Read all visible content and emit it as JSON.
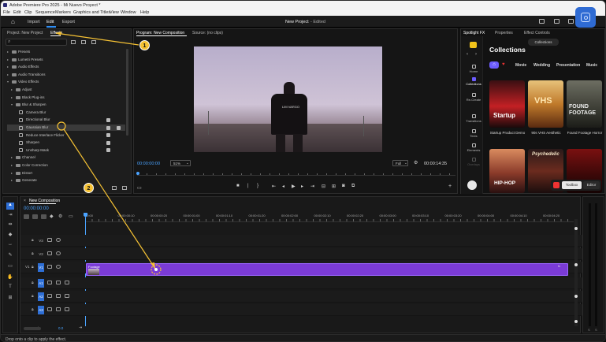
{
  "window": {
    "title": "Adobe Premiere Pro 2025 - Mi Nuevo Proyect *"
  },
  "menu": [
    "File",
    "Edit",
    "Clip",
    "Sequence",
    "Markers",
    "Graphics and Titles",
    "View",
    "Window",
    "Help"
  ],
  "workspace_tabs": {
    "import": "Import",
    "edit": "Edit",
    "export": "Export"
  },
  "project_name": "New Project",
  "project_status": "- Edited",
  "left_panel": {
    "tab_project": "Project: New Project",
    "tab_effects": "Effects",
    "tree": [
      {
        "label": "Presets",
        "depth": 0,
        "open": false,
        "kind": "folder"
      },
      {
        "label": "Lumetri Presets",
        "depth": 0,
        "open": false,
        "kind": "folder"
      },
      {
        "label": "Audio Effects",
        "depth": 0,
        "open": false,
        "kind": "folder"
      },
      {
        "label": "Audio Transitions",
        "depth": 0,
        "open": false,
        "kind": "folder"
      },
      {
        "label": "Video Effects",
        "depth": 0,
        "open": true,
        "kind": "folder"
      },
      {
        "label": "Adjust",
        "depth": 1,
        "open": false,
        "kind": "folder"
      },
      {
        "label": "Black Plug-ins",
        "depth": 1,
        "open": false,
        "kind": "folder"
      },
      {
        "label": "Blur & Sharpen",
        "depth": 1,
        "open": true,
        "kind": "folder"
      },
      {
        "label": "Camera Blur",
        "depth": 2,
        "kind": "fx",
        "badges": 0
      },
      {
        "label": "Directional Blur",
        "depth": 2,
        "kind": "fx",
        "badges": 1
      },
      {
        "label": "Gaussian Blur",
        "depth": 2,
        "kind": "fx",
        "badges": 2,
        "selected": true
      },
      {
        "label": "Reduce Interlace Flicker",
        "depth": 2,
        "kind": "fx",
        "badges": 1
      },
      {
        "label": "Sharpen",
        "depth": 2,
        "kind": "fx",
        "badges": 1
      },
      {
        "label": "Unsharp Mask",
        "depth": 2,
        "kind": "fx",
        "badges": 1
      },
      {
        "label": "Channel",
        "depth": 1,
        "open": false,
        "kind": "folder"
      },
      {
        "label": "Color Correction",
        "depth": 1,
        "open": false,
        "kind": "folder"
      },
      {
        "label": "Distort",
        "depth": 1,
        "open": false,
        "kind": "folder"
      },
      {
        "label": "Generate",
        "depth": 1,
        "open": false,
        "kind": "folder"
      }
    ]
  },
  "monitor": {
    "tab_program": "Program: New Composition",
    "tab_source": "Source: (no clips)",
    "timecode_left": "00:00:00:00",
    "zoom": "51%",
    "quality": "Full",
    "timecode_right": "00:00:14:35",
    "shirt_text": "LIM VARGO"
  },
  "spotlight": {
    "tab_spotlight": "Spotlight FX",
    "tab_properties": "Properties",
    "tab_effect_controls": "Effect Controls",
    "nav": [
      "Home",
      "Collections",
      "Re-Create",
      "Transitions",
      "Texts",
      "Elements",
      "Overlays"
    ],
    "collections_chip": "Collections",
    "heading": "Collections",
    "filters": [
      "Movie",
      "Wedding",
      "Presentation",
      "Music"
    ],
    "cards": [
      {
        "title": "Startup",
        "caption": "Startup Product Demo"
      },
      {
        "title": "VHS",
        "caption": "90s VHS Aesthetic"
      },
      {
        "title": "FOUND FOOTAGE",
        "caption": "Found Footage Horror"
      },
      {
        "title": "HIP-HOP",
        "caption": ""
      },
      {
        "title": "Psychedelic",
        "caption": ""
      },
      {
        "title": "",
        "caption": ""
      }
    ],
    "pill_toolbox": "Toolbox",
    "pill_editor": "Editor"
  },
  "timeline": {
    "sequence_tab": "New Composition",
    "timecode": "00:00:00:00",
    "ruler": [
      "00:00",
      "00:00:00:10",
      "00:00:00:20",
      "00:00:01:00",
      "00:00:01:10",
      "00:00:01:20",
      "00:00:02:00",
      "00:00:02:10",
      "00:00:02:20",
      "00:00:03:00",
      "00:00:03:10",
      "00:00:03:20",
      "00:00:04:00",
      "00:00:04:10",
      "00:00:04:20"
    ],
    "tracks": [
      "V3",
      "V2",
      "V1",
      "A1",
      "A2",
      "A3"
    ],
    "mix_label": "Mix",
    "mix_value": "0.0",
    "clip_label": "Footage"
  },
  "status_bar": "Drop onto a clip to apply the effect.",
  "callouts": [
    "1",
    "2"
  ],
  "colors": {
    "accent": "#2e8ef5",
    "clip": "#7b3bd6",
    "callout": "#f6c234"
  }
}
